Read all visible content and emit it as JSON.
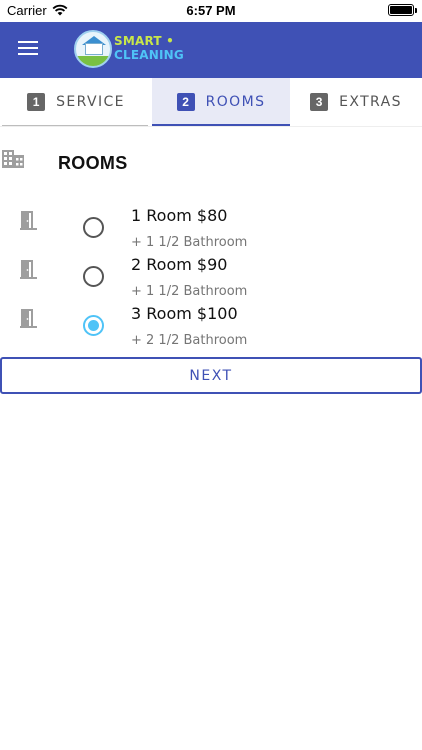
{
  "status_bar": {
    "carrier": "Carrier",
    "time": "6:57 PM",
    "wifi_icon": "wifi-icon",
    "battery_icon": "battery-icon"
  },
  "app_bar": {
    "menu_icon": "hamburger-menu-icon",
    "logo_line1": "SMART •",
    "logo_line2": "CLEANING",
    "background_color": "#3f51b5"
  },
  "tabs": [
    {
      "number": "1",
      "label": "SERVICE",
      "active": false
    },
    {
      "number": "2",
      "label": "ROOMS",
      "active": true
    },
    {
      "number": "3",
      "label": "EXTRAS",
      "active": false
    }
  ],
  "section": {
    "icon": "building-icon",
    "title": "ROOMS"
  },
  "rooms": [
    {
      "title": "1 Room $80",
      "subtitle": "+ 1 1/2 Bathroom",
      "selected": false,
      "icon": "door-icon"
    },
    {
      "title": "2 Room $90",
      "subtitle": "+ 1 1/2 Bathroom",
      "selected": false,
      "icon": "door-icon"
    },
    {
      "title": "3 Room $100",
      "subtitle": "+ 2 1/2 Bathroom",
      "selected": true,
      "icon": "door-icon"
    }
  ],
  "next_button": {
    "label": "NEXT"
  },
  "colors": {
    "primary": "#3f51b5",
    "radio_selected": "#4fc3f7",
    "active_tab_bg": "#e8eaf6"
  }
}
